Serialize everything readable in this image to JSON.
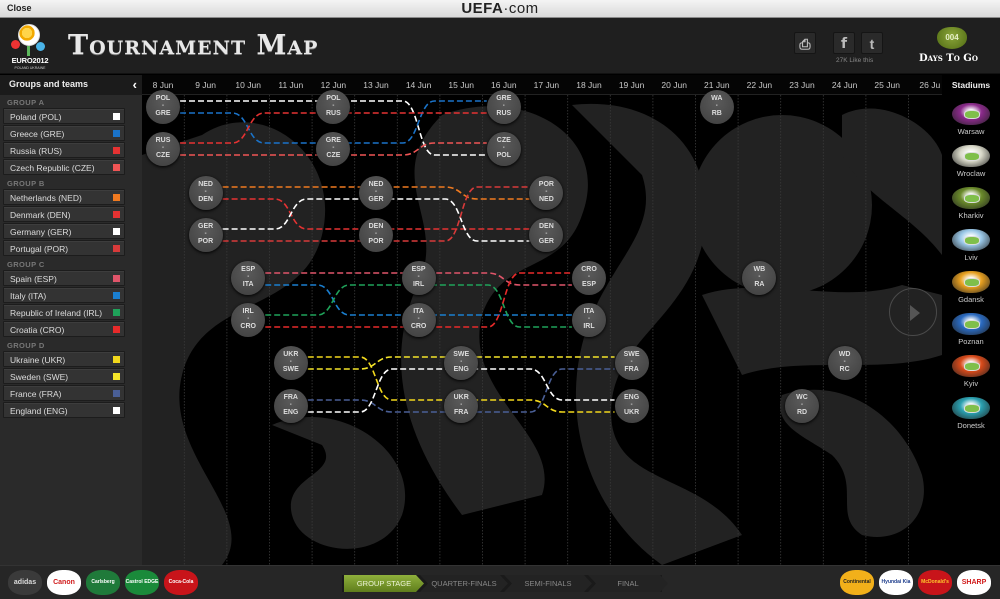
{
  "topbar": {
    "close_label": "Close",
    "brand_bold": "UEFA",
    "brand_rest": "·com"
  },
  "header": {
    "logo_text": "EURO2012",
    "logo_sub": "POLAND UKRAINE",
    "title": "Tournament Map",
    "print_icon": "⎙",
    "facebook_icon": "f",
    "twitter_icon": "t",
    "likes": "27K Like this",
    "days_count": "004",
    "days_label": "Days To Go"
  },
  "sidebar": {
    "title": "Groups and teams",
    "collapse_icon": "‹",
    "groups": [
      {
        "name": "GROUP A",
        "teams": [
          {
            "label": "Poland (POL)",
            "color": "#ffffff"
          },
          {
            "label": "Greece (GRE)",
            "color": "#1a73c9"
          },
          {
            "label": "Russia (RUS)",
            "color": "#e53232"
          },
          {
            "label": "Czech Republic (CZE)",
            "color": "#f05555"
          }
        ]
      },
      {
        "name": "GROUP B",
        "teams": [
          {
            "label": "Netherlands (NED)",
            "color": "#f07a20"
          },
          {
            "label": "Denmark (DEN)",
            "color": "#e53232"
          },
          {
            "label": "Germany (GER)",
            "color": "#ffffff"
          },
          {
            "label": "Portugal (POR)",
            "color": "#d83a3a"
          }
        ]
      },
      {
        "name": "GROUP C",
        "teams": [
          {
            "label": "Spain (ESP)",
            "color": "#e0556a"
          },
          {
            "label": "Italy (ITA)",
            "color": "#1a7fd0"
          },
          {
            "label": "Republic of Ireland (IRL)",
            "color": "#1fa35a"
          },
          {
            "label": "Croatia (CRO)",
            "color": "#e82a2a"
          }
        ]
      },
      {
        "name": "GROUP D",
        "teams": [
          {
            "label": "Ukraine (UKR)",
            "color": "#f2d81c"
          },
          {
            "label": "Sweden (SWE)",
            "color": "#f5e52a"
          },
          {
            "label": "France (FRA)",
            "color": "#4a5f96"
          },
          {
            "label": "England (ENG)",
            "color": "#ffffff"
          }
        ]
      }
    ]
  },
  "timeline": {
    "dates": [
      "8 Jun",
      "9 Jun",
      "10 Jun",
      "11 Jun",
      "12 Jun",
      "13 Jun",
      "14 Jun",
      "15 Jun",
      "16 Jun",
      "17 Jun",
      "18 Jun",
      "19 Jun",
      "20 Jun",
      "21 Jun",
      "22 Jun",
      "23 Jun",
      "24 Jun",
      "25 Jun",
      "26 Ju"
    ],
    "matches": [
      {
        "day": 0,
        "row": 0,
        "home": "POL",
        "away": "GRE"
      },
      {
        "day": 0,
        "row": 1,
        "home": "RUS",
        "away": "CZE"
      },
      {
        "day": 4,
        "row": 0,
        "home": "POL",
        "away": "RUS"
      },
      {
        "day": 4,
        "row": 1,
        "home": "GRE",
        "away": "CZE"
      },
      {
        "day": 8,
        "row": 0,
        "home": "GRE",
        "away": "RUS"
      },
      {
        "day": 8,
        "row": 1,
        "home": "CZE",
        "away": "POL"
      },
      {
        "day": 1,
        "row": 2,
        "home": "NED",
        "away": "DEN"
      },
      {
        "day": 1,
        "row": 3,
        "home": "GER",
        "away": "POR"
      },
      {
        "day": 5,
        "row": 2,
        "home": "NED",
        "away": "GER"
      },
      {
        "day": 5,
        "row": 3,
        "home": "DEN",
        "away": "POR"
      },
      {
        "day": 9,
        "row": 2,
        "home": "POR",
        "away": "NED"
      },
      {
        "day": 9,
        "row": 3,
        "home": "DEN",
        "away": "GER"
      },
      {
        "day": 2,
        "row": 4,
        "home": "ESP",
        "away": "ITA"
      },
      {
        "day": 2,
        "row": 5,
        "home": "IRL",
        "away": "CRO"
      },
      {
        "day": 6,
        "row": 4,
        "home": "ESP",
        "away": "IRL"
      },
      {
        "day": 6,
        "row": 5,
        "home": "ITA",
        "away": "CRO"
      },
      {
        "day": 10,
        "row": 4,
        "home": "CRO",
        "away": "ESP"
      },
      {
        "day": 10,
        "row": 5,
        "home": "ITA",
        "away": "IRL"
      },
      {
        "day": 3,
        "row": 6,
        "home": "UKR",
        "away": "SWE"
      },
      {
        "day": 3,
        "row": 7,
        "home": "FRA",
        "away": "ENG"
      },
      {
        "day": 7,
        "row": 6,
        "home": "SWE",
        "away": "ENG"
      },
      {
        "day": 7,
        "row": 7,
        "home": "UKR",
        "away": "FRA"
      },
      {
        "day": 11,
        "row": 6,
        "home": "SWE",
        "away": "FRA"
      },
      {
        "day": 11,
        "row": 7,
        "home": "ENG",
        "away": "UKR"
      },
      {
        "day": 13,
        "row": 0,
        "home": "WA",
        "away": "RB"
      },
      {
        "day": 14,
        "row": 4,
        "home": "WB",
        "away": "RA"
      },
      {
        "day": 16,
        "row": 6,
        "home": "WD",
        "away": "RC"
      },
      {
        "day": 15,
        "row": 7,
        "home": "WC",
        "away": "RD"
      }
    ],
    "next_icon": "play-arrow"
  },
  "stadiums": {
    "title": "Stadiums",
    "items": [
      {
        "name": "Warsaw",
        "color": "#8a2a8a"
      },
      {
        "name": "Wroclaw",
        "color": "#d8d8c8"
      },
      {
        "name": "Kharkiv",
        "color": "#6a8a2a"
      },
      {
        "name": "Lviv",
        "color": "#9ac8e8"
      },
      {
        "name": "Gdansk",
        "color": "#e8a020"
      },
      {
        "name": "Poznan",
        "color": "#2a6ac0"
      },
      {
        "name": "Kyiv",
        "color": "#d84a1a"
      },
      {
        "name": "Donetsk",
        "color": "#2aa0b0"
      }
    ]
  },
  "footer": {
    "sponsors_left": [
      {
        "name": "adidas",
        "bg": "#3a3a3a",
        "fg": "#ddd"
      },
      {
        "name": "Canon",
        "bg": "#ffffff",
        "fg": "#d01a1a"
      },
      {
        "name": "Carlsberg",
        "bg": "#1f7a3a",
        "fg": "#fff"
      },
      {
        "name": "Castrol EDGE",
        "bg": "#1a8a3a",
        "fg": "#fff"
      },
      {
        "name": "Coca-Cola",
        "bg": "#c8141a",
        "fg": "#fff"
      }
    ],
    "stages": [
      {
        "label": "GROUP STAGE",
        "active": true
      },
      {
        "label": "QUARTER-FINALS",
        "active": false
      },
      {
        "label": "SEMI-FINALS",
        "active": false
      },
      {
        "label": "FINAL",
        "active": false
      }
    ],
    "sponsors_right": [
      {
        "name": "Continental",
        "bg": "#f2b01a",
        "fg": "#222"
      },
      {
        "name": "Hyundai Kia",
        "bg": "#ffffff",
        "fg": "#1a3a8a"
      },
      {
        "name": "McDonald's",
        "bg": "#c8141a",
        "fg": "#ffc72c"
      },
      {
        "name": "SHARP",
        "bg": "#ffffff",
        "fg": "#d01a1a"
      }
    ]
  }
}
